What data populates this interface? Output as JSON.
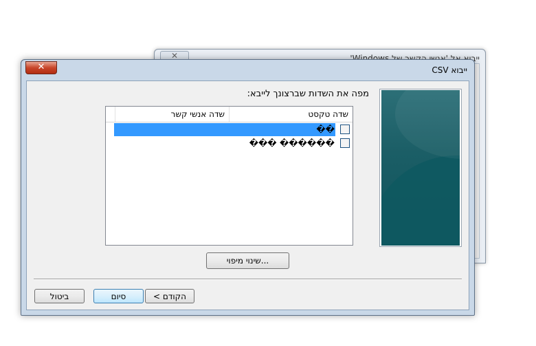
{
  "background_window": {
    "title": "ייבוא אל 'אנשי הקשר של Windows'",
    "close_glyph": "✕"
  },
  "dialog": {
    "title": "ייבוא CSV",
    "close_glyph": "✕"
  },
  "main": {
    "heading": "מפה את השדות שברצונך לייבא:",
    "columns": [
      "שדה טקסט",
      "שדה אנשי קשר"
    ],
    "rows": [
      {
        "text": "��",
        "selected": true,
        "checked": false
      },
      {
        "text": "������ ���",
        "selected": false,
        "checked": false
      }
    ],
    "change_mapping_label": "שינוי מיפוי..."
  },
  "footer": {
    "back_label": "< הקודם",
    "finish_label": "סיום",
    "cancel_label": "ביטול"
  },
  "colors": {
    "selection": "#3399ff",
    "close_button": "#c8462a",
    "side_image": "#1b5e66"
  }
}
